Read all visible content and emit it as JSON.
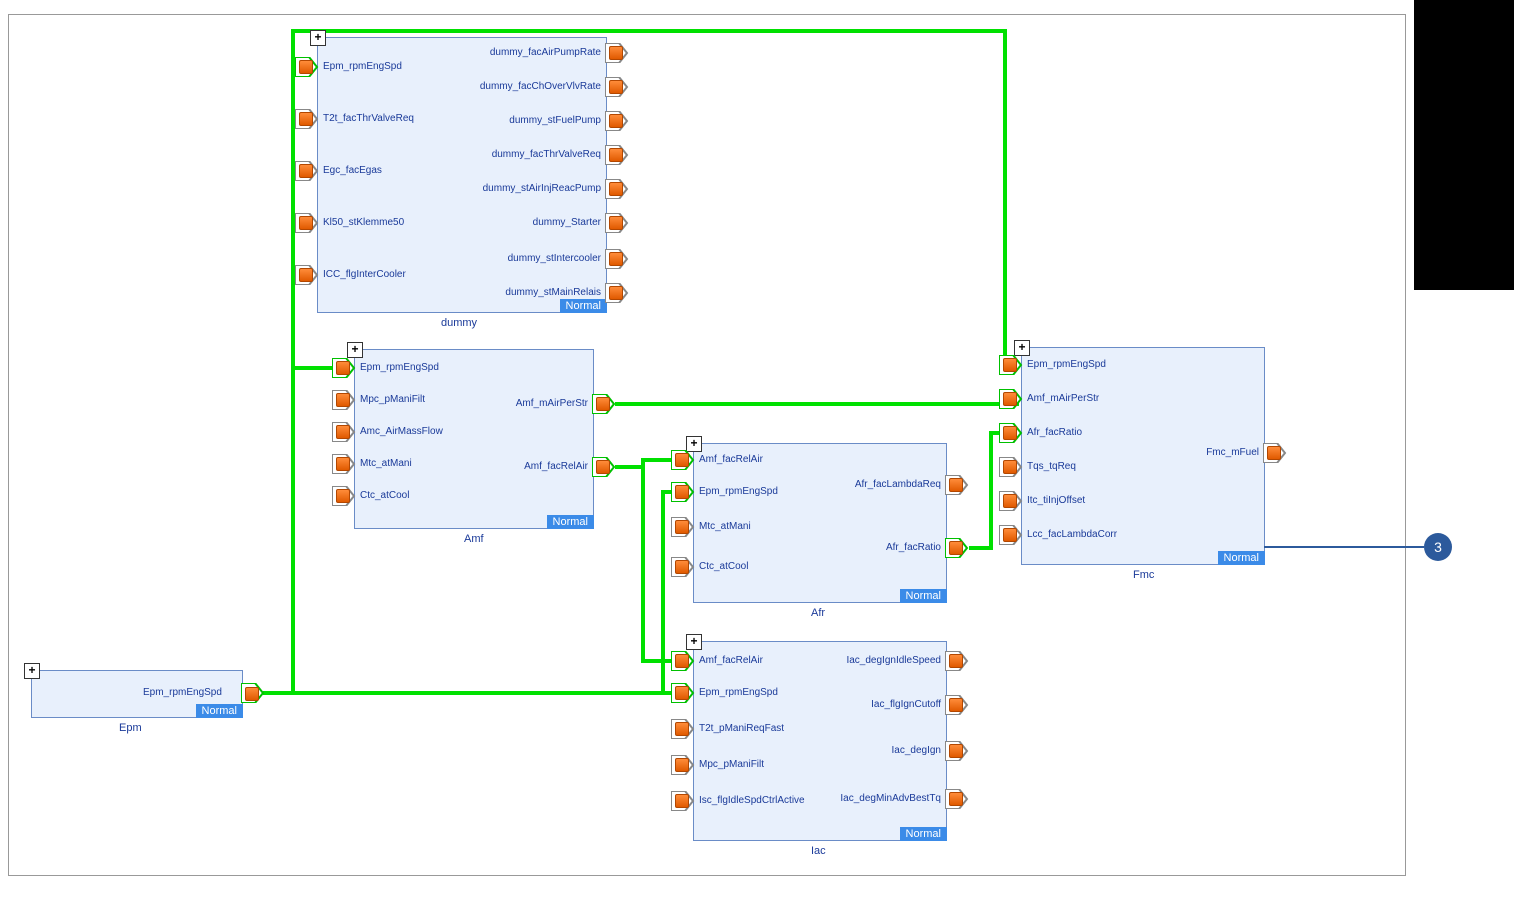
{
  "mode_label": "Normal",
  "plus_symbol": "+",
  "annotation": {
    "number": "3"
  },
  "blocks": {
    "epm": {
      "name": "Epm",
      "outputs": [
        "Epm_rpmEngSpd"
      ]
    },
    "dummy": {
      "name": "dummy",
      "inputs": [
        "Epm_rpmEngSpd",
        "T2t_facThrValveReq",
        "Egc_facEgas",
        "Kl50_stKlemme50",
        "ICC_flgInterCooler"
      ],
      "outputs": [
        "dummy_facAirPumpRate",
        "dummy_facChOverVlvRate",
        "dummy_stFuelPump",
        "dummy_facThrValveReq",
        "dummy_stAirInjReacPump",
        "dummy_Starter",
        "dummy_stIntercooler",
        "dummy_stMainRelais"
      ]
    },
    "amf": {
      "name": "Amf",
      "inputs": [
        "Epm_rpmEngSpd",
        "Mpc_pManiFilt",
        "Amc_AirMassFlow",
        "Mtc_atMani",
        "Ctc_atCool"
      ],
      "outputs": [
        "Amf_mAirPerStr",
        "Amf_facRelAir"
      ]
    },
    "afr": {
      "name": "Afr",
      "inputs": [
        "Amf_facRelAir",
        "Epm_rpmEngSpd",
        "Mtc_atMani",
        "Ctc_atCool"
      ],
      "outputs": [
        "Afr_facLambdaReq",
        "Afr_facRatio"
      ]
    },
    "iac": {
      "name": "Iac",
      "inputs": [
        "Amf_facRelAir",
        "Epm_rpmEngSpd",
        "T2t_pManiReqFast",
        "Mpc_pManiFilt",
        "Isc_flgIdleSpdCtrlActive"
      ],
      "outputs": [
        "Iac_degIgnIdleSpeed",
        "Iac_flgIgnCutoff",
        "Iac_degIgn",
        "Iac_degMinAdvBestTq"
      ]
    },
    "fmc": {
      "name": "Fmc",
      "inputs": [
        "Epm_rpmEngSpd",
        "Amf_mAirPerStr",
        "Afr_facRatio",
        "Tqs_tqReq",
        "Itc_tiInjOffset",
        "Lcc_facLambdaCorr"
      ],
      "outputs": [
        "Fmc_mFuel"
      ]
    }
  }
}
